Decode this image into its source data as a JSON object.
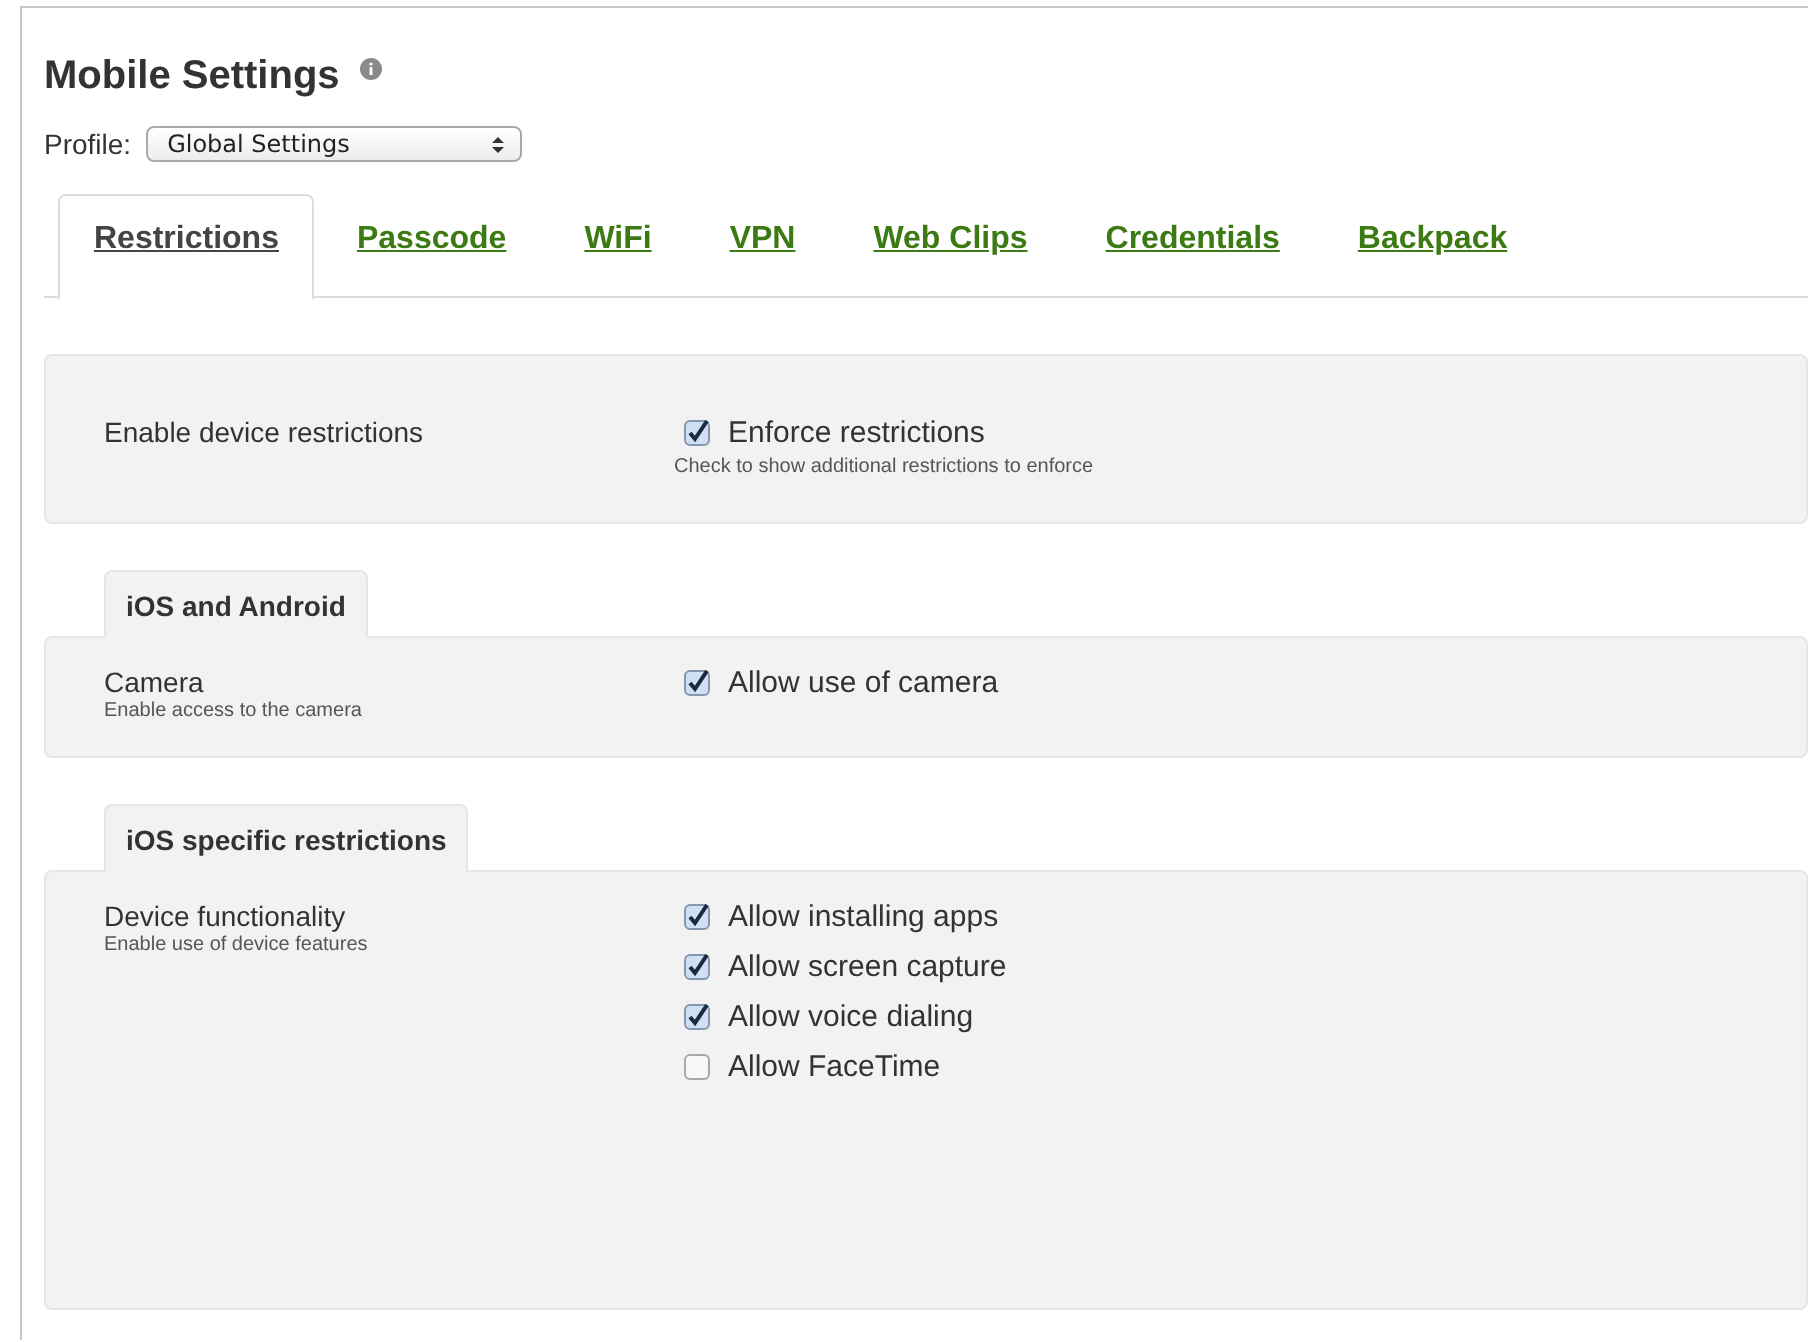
{
  "page": {
    "title": "Mobile Settings"
  },
  "profile": {
    "label": "Profile:",
    "value": "Global Settings"
  },
  "tabs": [
    {
      "label": "Restrictions",
      "selected": true
    },
    {
      "label": "Passcode",
      "selected": false
    },
    {
      "label": "WiFi",
      "selected": false
    },
    {
      "label": "VPN",
      "selected": false
    },
    {
      "label": "Web Clips",
      "selected": false
    },
    {
      "label": "Credentials",
      "selected": false
    },
    {
      "label": "Backpack",
      "selected": false
    }
  ],
  "sections": [
    {
      "rows": [
        {
          "label": "Enable device restrictions",
          "options": [
            {
              "label": "Enforce restrictions",
              "checked": true
            }
          ],
          "note": "Check to show additional restrictions to enforce"
        }
      ]
    },
    {
      "heading": "iOS and Android",
      "rows": [
        {
          "label": "Camera",
          "hint": "Enable access to the camera",
          "options": [
            {
              "label": "Allow use of camera",
              "checked": true
            }
          ]
        }
      ]
    },
    {
      "heading": "iOS specific restrictions",
      "rows": [
        {
          "label": "Device functionality",
          "hint": "Enable use of device features",
          "options": [
            {
              "label": "Allow installing apps",
              "checked": true
            },
            {
              "label": "Allow screen capture",
              "checked": true
            },
            {
              "label": "Allow voice dialing",
              "checked": true
            },
            {
              "label": "Allow FaceTime",
              "checked": false
            }
          ]
        }
      ]
    }
  ]
}
